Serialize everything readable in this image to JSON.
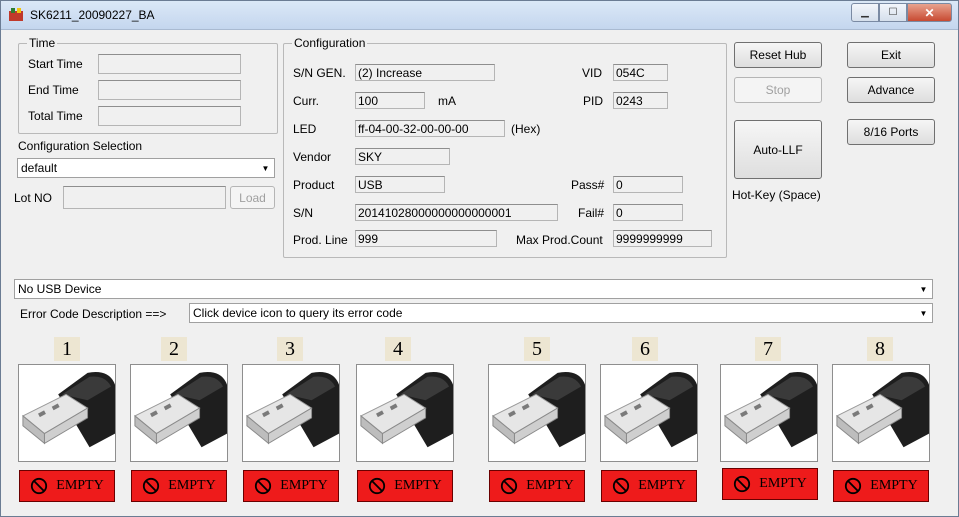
{
  "window": {
    "title": "SK6211_20090227_BA"
  },
  "time_group": {
    "title": "Time",
    "start_label": "Start Time",
    "start_value": "",
    "end_label": "End Time",
    "end_value": "",
    "total_label": "Total Time",
    "total_value": ""
  },
  "config_selection": {
    "label": "Configuration Selection",
    "value": "default"
  },
  "lot": {
    "label": "Lot NO",
    "value": "",
    "load_button": "Load"
  },
  "configuration": {
    "title": "Configuration",
    "sn_gen_label": "S/N GEN.",
    "sn_gen_value": "(2) Increase",
    "curr_label": "Curr.",
    "curr_value": "100",
    "curr_unit": "mA",
    "led_label": "LED",
    "led_value": "ff-04-00-32-00-00-00",
    "led_unit": "(Hex)",
    "vendor_label": "Vendor",
    "vendor_value": "SKY",
    "product_label": "Product",
    "product_value": "USB",
    "sn_label": "S/N",
    "sn_value": "20141028000000000000001",
    "prod_line_label": "Prod. Line",
    "prod_line_value": "999",
    "vid_label": "VID",
    "vid_value": "054C",
    "pid_label": "PID",
    "pid_value": "0243",
    "pass_label": "Pass#",
    "pass_value": "0",
    "fail_label": "Fail#",
    "fail_value": "0",
    "max_prod_label": "Max Prod.Count",
    "max_prod_value": "9999999999"
  },
  "buttons": {
    "reset_hub": "Reset Hub",
    "stop": "Stop",
    "auto_llf": "Auto-LLF",
    "hotkey": "Hot-Key (Space)",
    "exit": "Exit",
    "advance": "Advance",
    "ports": "8/16 Ports"
  },
  "device_status": {
    "value": "No USB Device"
  },
  "error_code": {
    "label": "Error Code Description ==>",
    "value": "Click device icon to query its error code"
  },
  "ports": [
    {
      "number": "1",
      "status": "EMPTY"
    },
    {
      "number": "2",
      "status": "EMPTY"
    },
    {
      "number": "3",
      "status": "EMPTY"
    },
    {
      "number": "4",
      "status": "EMPTY"
    },
    {
      "number": "5",
      "status": "EMPTY"
    },
    {
      "number": "6",
      "status": "EMPTY"
    },
    {
      "number": "7",
      "status": "EMPTY"
    },
    {
      "number": "8",
      "status": "EMPTY"
    }
  ],
  "colors": {
    "status_empty": "#ee1b1b",
    "titlebar": "#c4d6ee"
  }
}
